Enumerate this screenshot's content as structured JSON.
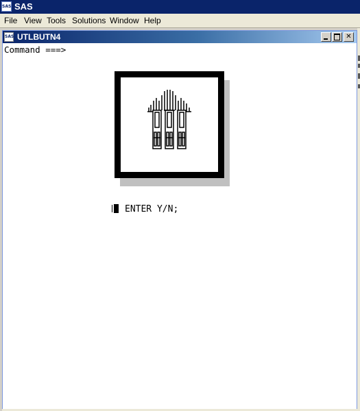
{
  "app": {
    "title": "SAS",
    "icon_label": "SAS",
    "icon": "sas-app-icon"
  },
  "menubar": {
    "items": [
      "File",
      "View",
      "Tools",
      "Solutions",
      "Window",
      "Help"
    ]
  },
  "child_window": {
    "title": "UTLBUTN4",
    "icon": "sas-window-icon",
    "icon_label": "SAS",
    "buttons": {
      "minimize": "minimize-icon",
      "maximize": "maximize-icon",
      "close": "close-icon"
    },
    "close_glyph": "✕",
    "command_label": "Command ===>"
  },
  "logo": {
    "icon": "sas-logo-icon",
    "frame_color": "#000000",
    "shadow_color": "#c0c0c0"
  },
  "prompt": {
    "text": "ENTER Y/N;"
  },
  "colors": {
    "title_bar": "#0a246a",
    "menu_bg": "#ece9d8",
    "content_bg": "#ffffff"
  }
}
